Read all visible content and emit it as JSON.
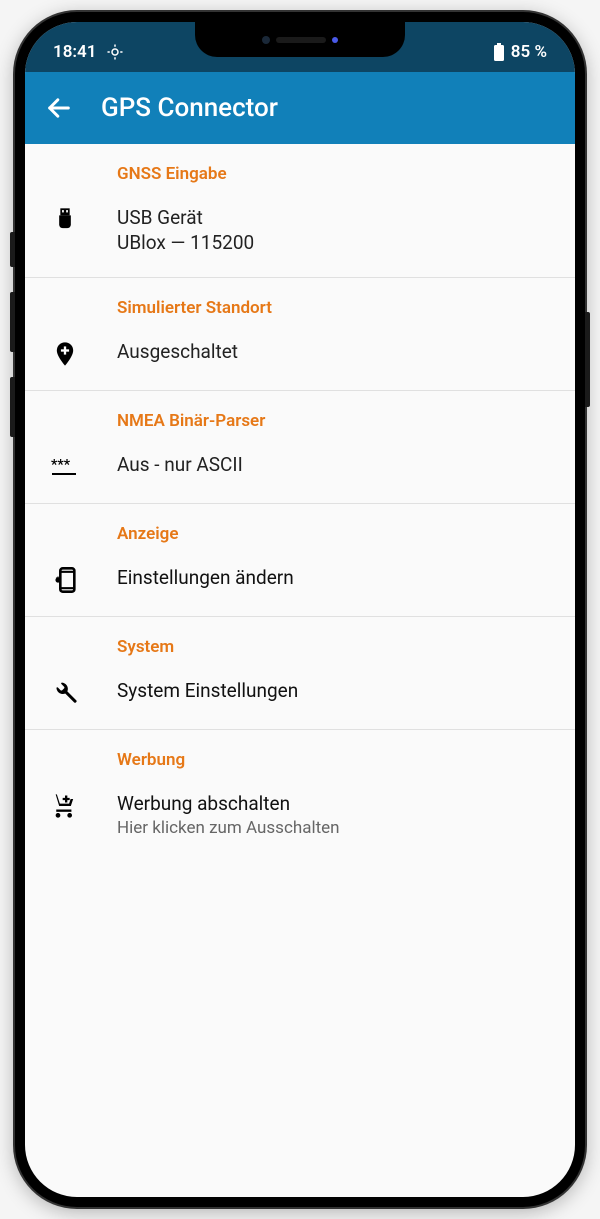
{
  "status": {
    "time": "18:41",
    "battery": "85 %"
  },
  "header": {
    "title": "GPS Connector"
  },
  "sections": {
    "gnss": {
      "header": "GNSS Eingabe",
      "title": "USB Gerät",
      "subtitle": "UBlox — 115200"
    },
    "mock": {
      "header": "Simulierter Standort",
      "title": "Ausgeschaltet"
    },
    "nmea": {
      "header": "NMEA Binär-Parser",
      "title": "Aus - nur ASCII"
    },
    "display": {
      "header": "Anzeige",
      "title": "Einstellungen ändern"
    },
    "system": {
      "header": "System",
      "title": "System Einstellungen"
    },
    "ads": {
      "header": "Werbung",
      "title": "Werbung abschalten",
      "subtitle": "Hier klicken zum Ausschalten"
    }
  }
}
